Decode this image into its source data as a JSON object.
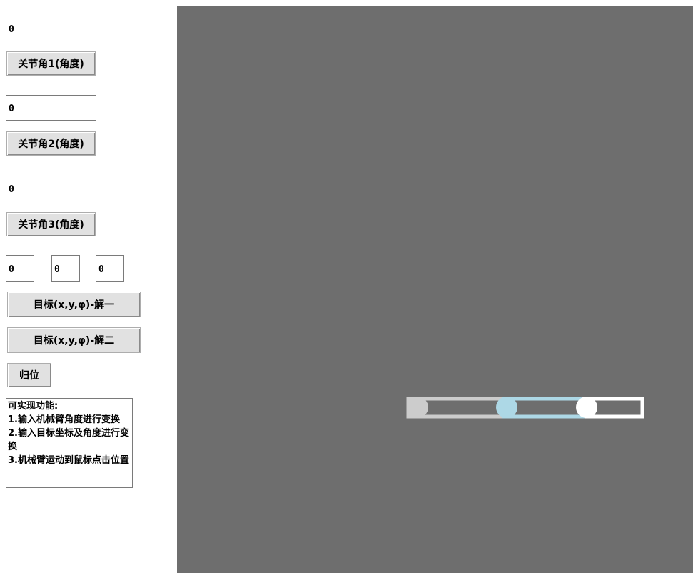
{
  "controls": {
    "joint1": {
      "value": "0",
      "button_label": "关节角1(角度)"
    },
    "joint2": {
      "value": "0",
      "button_label": "关节角2(角度)"
    },
    "joint3": {
      "value": "0",
      "button_label": "关节角3(角度)"
    },
    "target": {
      "x": "0",
      "y": "0",
      "phi": "0"
    },
    "solve1_label": "目标(x,y,φ)-解一",
    "solve2_label": "目标(x,y,φ)-解二",
    "reset_label": "归位"
  },
  "info": {
    "text": "可实现功能:\n1.输入机械臂角度进行变换   2.输入目标坐标及角度进行变换\n3.机械臂运动到鼠标点击位置"
  },
  "canvas": {
    "background": "#6e6e6e",
    "links": [
      {
        "name": "link-1",
        "color": "#cccccc"
      },
      {
        "name": "link-2",
        "color": "#add8e6"
      },
      {
        "name": "link-3",
        "color": "#ffffff"
      }
    ]
  }
}
